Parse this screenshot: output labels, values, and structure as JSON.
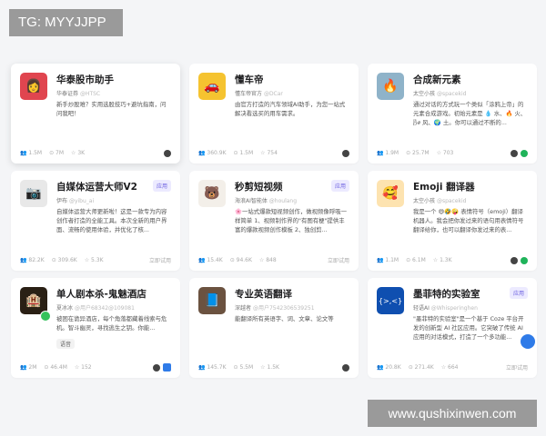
{
  "overlay": {
    "tg": "TG: MYYJJPP",
    "watermark": "www.qushixinwen.com"
  },
  "cards": [
    {
      "title": "华泰股市助手",
      "author": "华泰证券",
      "handle": "@HTSC",
      "desc": "新手炒股难？实用选股技巧+避坑指南，问问我吧！",
      "stats": [
        "1.5M",
        "7M",
        "3K"
      ],
      "icon_color": "#e0454f",
      "icon": "👩"
    },
    {
      "title": "懂车帝",
      "author": "懂车帝官方",
      "handle": "@DCar",
      "desc": "由官方打造的汽车领域AI助手，为您一站式解决看选买的用车需求。",
      "stats": [
        "360.9K",
        "1.5M",
        "754"
      ],
      "icon_color": "#f5c330",
      "icon": "🚗"
    },
    {
      "title": "合成新元素",
      "author": "太空小孩",
      "handle": "@spacekid",
      "desc": "通过对话的方式玩一个类似「涂鸦上帝」的元素合成游戏。初始元素是 💧 水、🔥 火、🌬 风、🌍 土。你可以通过不断的...",
      "stats": [
        "1.9M",
        "25.7M",
        "703"
      ],
      "icon_color": "#8fb3c9",
      "icon": "🔥"
    },
    {
      "title": "自媒体运营大师V2",
      "author": "伊布",
      "handle": "@yibu_ai",
      "desc": "自媒体运营大师更新啦！这是一款专为内容创作者打造的全能工具。本次全新的用户界面、流畅的使用体验，并优化了核...",
      "stats": [
        "82.2K",
        "309.6K",
        "5.3K"
      ],
      "tag": "应用",
      "try": "立即试用",
      "icon_color": "#e8e8e8",
      "icon": "📷"
    },
    {
      "title": "秒剪短视频",
      "author": "海浪AI智能体",
      "handle": "@houlang",
      "desc": "🌸一站式爆款短视频创作，做视频像呼吸一样简单 1、视频制作界的\"有图有梗\"提供丰富的爆款视频创作模板 2、独创剪...",
      "stats": [
        "15.4K",
        "94.6K",
        "848"
      ],
      "tag": "应用",
      "try": "立即试用",
      "icon_color": "#f3efe9",
      "icon": "🐻"
    },
    {
      "title": "Emoji 翻译器",
      "author": "太空小孩",
      "handle": "@spacekid",
      "desc": "我是一个 😄🤣🤪 表情符号（emoji）翻译机器人。我会把你发过来的语句用表情符号翻译给你，也可以翻译你发过来的表...",
      "stats": [
        "1.1M",
        "6.1M",
        "1.3K"
      ],
      "icon_color": "#fde3b0",
      "icon": "🥰"
    },
    {
      "title": "单人剧本杀-鬼魅酒店",
      "author": "夏冰冰",
      "handle": "@用户68342@109081",
      "desc": "被困在诡异酒店，每个角落都藏着线索与危机。智斗幽灵，寻找逃生之钥。你能...",
      "chip": "语音",
      "stats": [
        "2M",
        "46.4M",
        "152"
      ],
      "icon_color": "#2a2015",
      "icon": "🏨"
    },
    {
      "title": "专业英语翻译",
      "author": "深越者",
      "handle": "@用户7542306539251",
      "desc": "能翻译所有英语字、词、文章、论文等",
      "stats": [
        "145.7K",
        "5.5M",
        "1.5K"
      ],
      "icon_color": "#6b5240",
      "icon": "📘"
    },
    {
      "title": "墨菲特的实验室",
      "author": "轻语AI",
      "handle": "@Whisperinghen",
      "desc": "\"墨菲特的实验室\"是一个基于 Coze 平台开发的创新型 AI 社区应用。它突破了传统 AI 应用的对话模式，打造了一个多功能...",
      "stats": [
        "20.8K",
        "271.4K",
        "664"
      ],
      "tag": "应用",
      "try": "立即试用",
      "icon_color": "#0f4fb0",
      "icon": "{>,<}"
    }
  ]
}
